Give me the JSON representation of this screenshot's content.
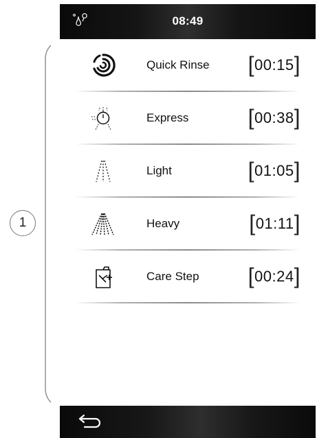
{
  "callout": {
    "number": "1"
  },
  "header": {
    "time": "08:49",
    "status_icon": "water-drop-icon"
  },
  "programs": [
    {
      "icon": "quick-rinse-icon",
      "label": "Quick Rinse",
      "duration": "00:15"
    },
    {
      "icon": "express-icon",
      "label": "Express",
      "duration": "00:38"
    },
    {
      "icon": "light-spray-icon",
      "label": "Light",
      "duration": "01:05"
    },
    {
      "icon": "heavy-spray-icon",
      "label": "Heavy",
      "duration": "01:11"
    },
    {
      "icon": "care-step-icon",
      "label": "Care Step",
      "duration": "00:24"
    }
  ],
  "footer": {
    "back_icon": "back-arrow-icon"
  },
  "colors": {
    "bar": "#111111",
    "text": "#111111",
    "divider": "#8a8a8a",
    "background": "#ffffff"
  }
}
